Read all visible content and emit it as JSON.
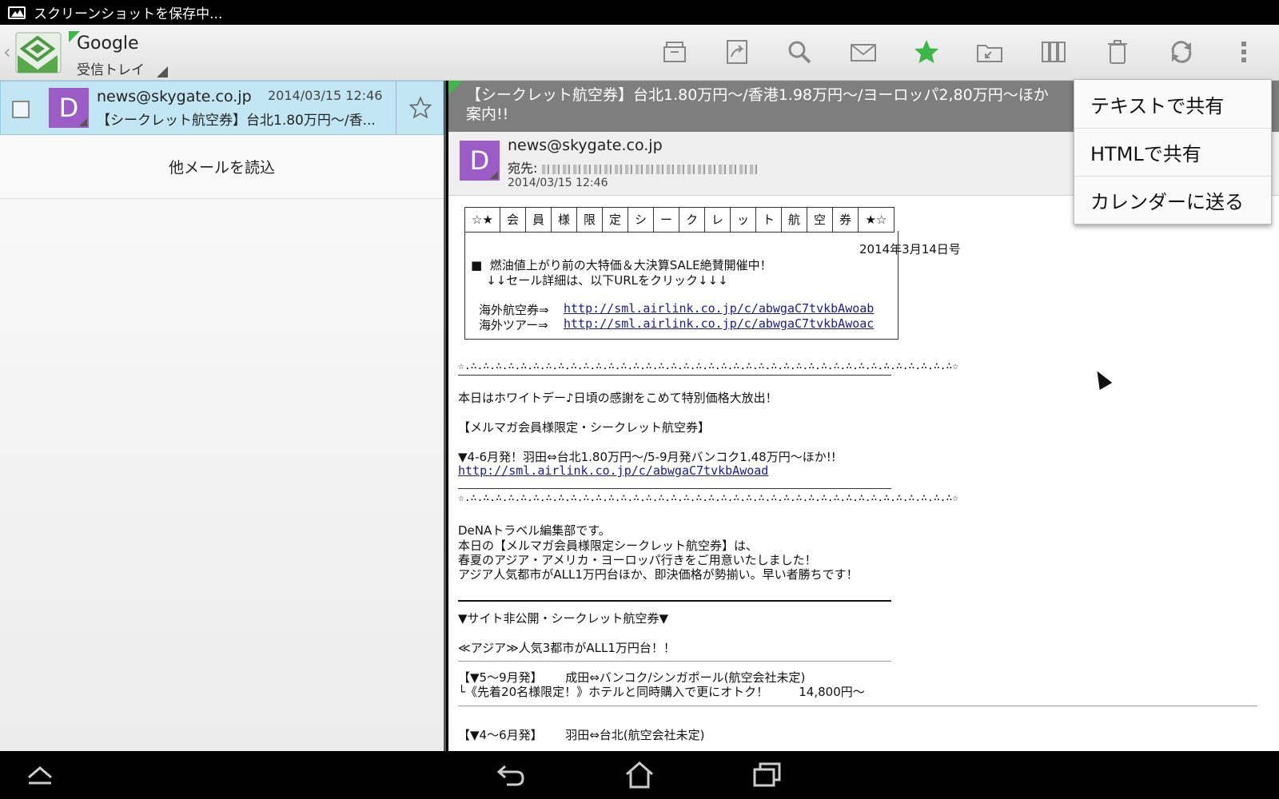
{
  "status_bar": {
    "notification": "スクリーンショットを保存中..."
  },
  "account": {
    "name": "Google",
    "folder": "受信トレイ"
  },
  "toolbar": {
    "icons": [
      "archive-icon",
      "forward-icon",
      "search-icon",
      "mail-icon",
      "star-icon",
      "move-folder-icon",
      "columns-icon",
      "trash-icon",
      "refresh-icon",
      "overflow-icon"
    ],
    "accent": "#3fb64a"
  },
  "list": {
    "message": {
      "avatar_letter": "D",
      "from": "news@skygate.co.jp",
      "date": "2014/03/15 12:46",
      "subject": "【シークレット航空券】台北1.80万円～/香..."
    },
    "load_more": "他メールを読込"
  },
  "reader": {
    "subject": "【シークレット航空券】台北1.80万円～/香港1.98万円～/ヨーロッパ2,80万円～ほか",
    "subject_line2": "案内!!",
    "avatar_letter": "D",
    "from": "news@skygate.co.jp",
    "to_label": "宛先:",
    "date": "2014/03/15 12:46",
    "box_chars": [
      "☆★",
      "会",
      "員",
      "様",
      "限",
      "定",
      "シ",
      "ー",
      "ク",
      "レ",
      "ッ",
      "ト",
      "航",
      "空",
      "券",
      "★☆"
    ],
    "issue_date": "2014年3月14日号",
    "sale_line": "■  燃油値上がり前の大特価＆大決算SALE絶賛開催中！",
    "click_line": "    ↓↓セール詳細は、以下URLをクリック↓↓↓",
    "air_label": "海外航空券⇒",
    "air_url": "http://sml.airlink.co.jp/c/abwgaC7tvkbAwoab",
    "tour_label": "海外ツアー⇒",
    "tour_url": "http://sml.airlink.co.jp/c/abwgaC7tvkbAwoac",
    "deco_line": "☆.∴.∴.∴.∴.∴.∴.∴.∴.∴.∴.∴.∴.∴.∴.∴.∴.∴.∴.∴.∴.∴.∴.∴.∴.∴.∴.∴.∴.∴.∴.∴.∴.∴.∴.∴.∴.∴.∴.∴☆",
    "white_day": "本日はホワイトデー♪日頃の感謝をこめて特別価格大放出！",
    "members": "【メルマガ会員様限定・シークレット航空券】",
    "deal1": "▼4-6月発！羽田⇔台北1.80万円～/5-9月発バンコク1.48万円～ほか!!",
    "deal1_url": "http://sml.airlink.co.jp/c/abwgaC7tvkbAwoad",
    "editor1": "DeNAトラベル編集部です。",
    "editor2": "本日の【メルマガ会員様限定シークレット航空券】は、",
    "editor3": "春夏のアジア・アメリカ・ヨーロッパ行きをご用意いたしました！",
    "editor4": "アジア人気都市がALL1万円台ほか、即決価格が勢揃い。早い者勝ちです！",
    "secret": "▼サイト非公開・シークレット航空券▼",
    "asia": "≪アジア≫人気3都市がALL1万円台！！",
    "fare1_a": "【▼5～9月発】      成田⇔バンコク/シンガポール(航空会社未定)",
    "fare1_b": "└《先着20名様限定！》ホテルと同時購入で更にオトク！        14,800円～",
    "fare2_a": "【▼4～6月発】      羽田⇔台北(航空会社未定)"
  },
  "menu": {
    "items": [
      "テキストで共有",
      "HTMLで共有",
      "カレンダーに送る"
    ]
  }
}
